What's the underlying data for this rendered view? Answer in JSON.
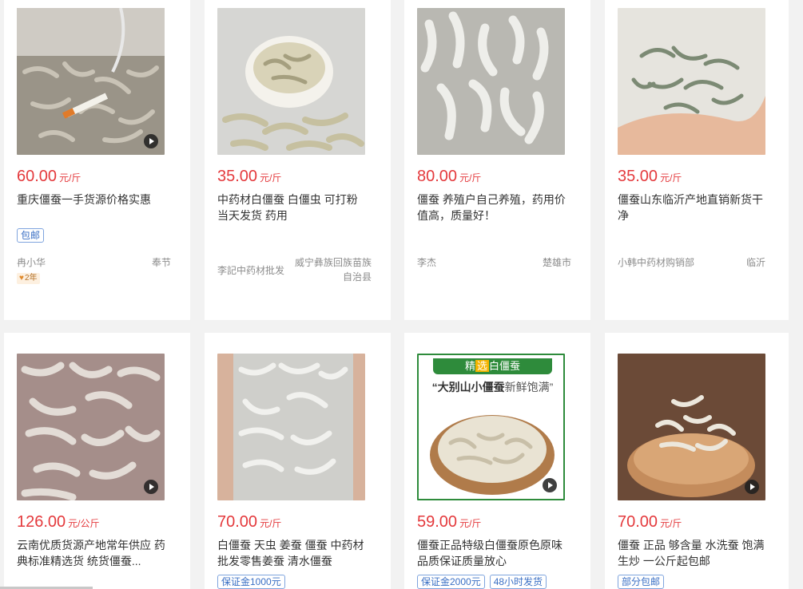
{
  "cards": [
    {
      "price": "60.00",
      "unit": "元/斤",
      "title": "重庆僵蚕一手货源价格实惠",
      "tags": [
        "包邮"
      ],
      "seller": "冉小华",
      "location": "奉节",
      "badge": "2年",
      "has_play": true,
      "image_desc": "bag-of-silkworms"
    },
    {
      "price": "35.00",
      "unit": "元/斤",
      "title": "中药材白僵蚕 白僵虫 可打粉 当天发货 药用",
      "tags": [],
      "seller": "李記中药材批发",
      "location": "威宁彝族回族苗族自治县",
      "badge": "",
      "has_play": false,
      "image_desc": "bowl-of-silkworms"
    },
    {
      "price": "80.00",
      "unit": "元/斤",
      "title": "僵蚕 养殖户自己养殖，药用价值高，质量好！",
      "tags": [],
      "seller": "李杰",
      "location": "楚雄市",
      "badge": "",
      "has_play": false,
      "image_desc": "white-silkworms"
    },
    {
      "price": "35.00",
      "unit": "元/斤",
      "title": "僵蚕山东临沂产地直销新货干净",
      "tags": [],
      "seller": "小韩中药材购销部",
      "location": "临沂",
      "badge": "",
      "has_play": false,
      "image_desc": "hand-holding-silkworms"
    },
    {
      "price": "126.00",
      "unit": "元/公斤",
      "title": "云南优质货源产地常年供应 药典标准精选货 统货僵蚕...",
      "tags": [],
      "seller": "",
      "location": "",
      "badge": "",
      "has_play": true,
      "image_desc": "pink-silkworms"
    },
    {
      "price": "70.00",
      "unit": "元/斤",
      "title": "白僵蚕 天虫 姜蚕 僵蚕 中药材批发零售姜蚕 清水僵蚕",
      "tags": [
        "保证金1000元"
      ],
      "seller": "",
      "location": "",
      "badge": "",
      "has_play": false,
      "image_desc": "hands-holding-silkworms"
    },
    {
      "price": "59.00",
      "unit": "元/斤",
      "title": "僵蚕正品特级白僵蚕原色原味品质保证质量放心",
      "tags": [
        "保证金2000元",
        "48小时发货"
      ],
      "seller": "",
      "location": "",
      "badge": "",
      "has_play": true,
      "image_desc": "promo-bowl",
      "promo": {
        "banner_pre": "精",
        "banner_hi": "选",
        "banner_post": "白僵蚕",
        "sub_bold": "“大别山小僵蚕",
        "sub_light": "新鲜饱满”"
      }
    },
    {
      "price": "70.00",
      "unit": "元/斤",
      "title": "僵蚕 正品 够含量 水洗蚕 饱满 生炒 一公斤起包邮",
      "tags": [
        "部分包邮"
      ],
      "seller": "",
      "location": "",
      "badge": "",
      "has_play": true,
      "image_desc": "wood-slab-silkworms"
    }
  ],
  "colors": {
    "price": "#e4393c",
    "tag_border": "#7fa4de",
    "tag_text": "#3a6fc4",
    "background": "#f2f2f2"
  }
}
